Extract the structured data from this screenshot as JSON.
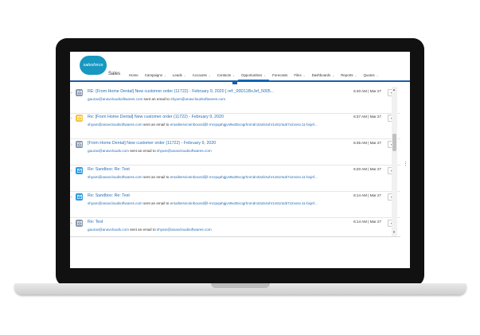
{
  "app": {
    "logo_text": "salesforce",
    "name": "Sales"
  },
  "nav": [
    {
      "label": "Home",
      "chevron": false
    },
    {
      "label": "Campaigns",
      "chevron": true
    },
    {
      "label": "Leads",
      "chevron": true
    },
    {
      "label": "Accounts",
      "chevron": true
    },
    {
      "label": "Contacts",
      "chevron": true
    },
    {
      "label": "Opportunities",
      "chevron": true,
      "active": true
    },
    {
      "label": "Forecasts",
      "chevron": false
    },
    {
      "label": "Files",
      "chevron": true
    },
    {
      "label": "Dashboards",
      "chevron": true
    },
    {
      "label": "Reports",
      "chevron": true
    },
    {
      "label": "Quotes",
      "chevron": true
    }
  ],
  "feed": [
    {
      "icon_color": "#8a99ad",
      "icon": "email-icon",
      "subject": "RE: [From Home Dental] New customer order (11722) - February 9, 2020 [ ref:_00D11BxJef_5005...",
      "from": "gaurav@anavcloudsoftwares.com",
      "action": "sent an email to",
      "to": "shyam@anavcloudsoftwares.com",
      "time": "6:40 AM | Mar 27"
    },
    {
      "icon_color": "#f4c542",
      "icon": "email-icon",
      "subject": "Re: [From Home Dental] New customer order (11722) - February 9, 2020",
      "from": "shyam@anavcloudsoftwares.com",
      "action": "sent an email to",
      "to": "emailserviceinbound@l-mcrpqahgjvs9w35cogrhnmdn32ah4uhr1x51rta3i7x2vosv.11-bxjef...",
      "time": "6:37 AM | Mar 27"
    },
    {
      "icon_color": "#8a99ad",
      "icon": "email-icon",
      "subject": "[From Home Dental] New customer order (11722) - February 9, 2020",
      "from": "gaurav@anavclouds.com",
      "action": "sent an email to",
      "to": "shyam@anavcloudsoftwares.com",
      "time": "6:35 AM | Mar 27"
    },
    {
      "icon_color": "#2e9be0",
      "icon": "email-icon",
      "subject": "Re: Sandbox: Re: Test",
      "from": "shyam@anavcloudsoftwares.com",
      "action": "sent an email to",
      "to": "emailserviceinbound@l-mcrpqahgjvs9w35cogrhnmdn32ah4uhr1x51rta3i7x2vosv.11-bxjef...",
      "time": "6:20 AM | Mar 27"
    },
    {
      "icon_color": "#2e9be0",
      "icon": "email-icon",
      "subject": "Re: Sandbox: Re: Test",
      "from": "shyam@anavcloudsoftwares.com",
      "action": "sent an email to",
      "to": "emailserviceinbound@l-mcrpqahgjvs9w35cogrhnmdn32ah4uhr1x51rta3i7x2vosv.11-bxjef...",
      "time": "6:14 AM | Mar 27"
    },
    {
      "icon_color": "#8a99ad",
      "icon": "email-icon",
      "subject": "Re: Test",
      "from": "gaurav@anavclouds.com",
      "action": "sent an email to",
      "to": "shyam@anavcloudsoftwares.com",
      "time": "6:14 AM | Mar 27"
    }
  ],
  "glyphs": {
    "expander": "›",
    "dropdown": "▾",
    "scroll_up": "▲",
    "scroll_down": "▼",
    "kebab": "⋮",
    "nav_chevron": "⌄"
  }
}
